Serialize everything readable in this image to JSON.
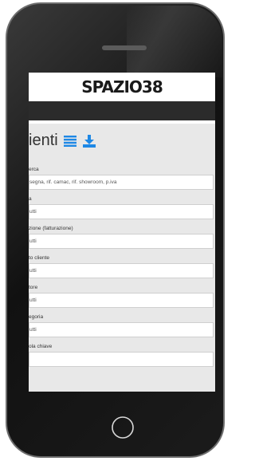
{
  "brand": {
    "logo_text": "SPAZIO38"
  },
  "page": {
    "title": "ienti"
  },
  "icons": {
    "list": "list-icon",
    "download": "download-icon"
  },
  "colors": {
    "accent": "#1e88e5",
    "nav": "#2b2b2b",
    "background": "#e8e8e8"
  },
  "filters": [
    {
      "label": "erca",
      "value": "segna, rif. camac, rif. showroom, p.iva"
    },
    {
      "label": "a",
      "value": "utti"
    },
    {
      "label": "zione (fatturazione)",
      "value": "utti"
    },
    {
      "label": "to cliente",
      "value": "utti"
    },
    {
      "label": "tore",
      "value": "utti"
    },
    {
      "label": "egoria",
      "value": "utti"
    },
    {
      "label": "ola chiave",
      "value": ""
    }
  ]
}
